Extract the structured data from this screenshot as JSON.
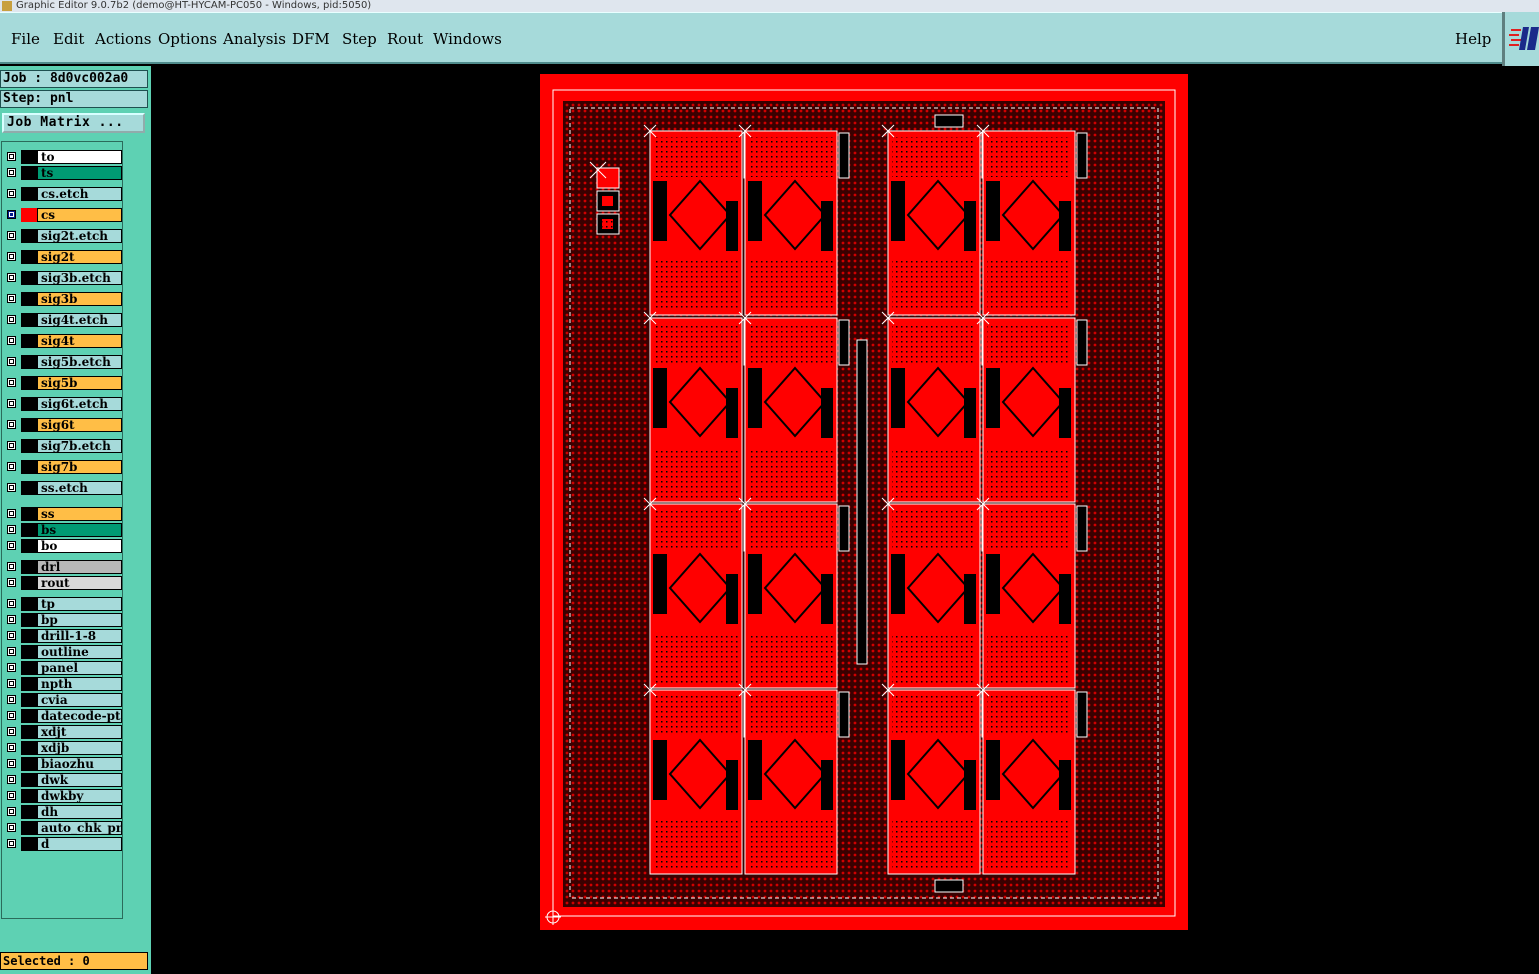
{
  "window": {
    "title": "Graphic Editor 9.0.7b2 (demo@HT-HYCAM-PC050 - Windows, pid:5050)"
  },
  "menu": {
    "file": "File",
    "edit": "Edit",
    "actions": "Actions",
    "options": "Options",
    "analysis": "Analysis",
    "dfm": "DFM",
    "step": "Step",
    "rout": "Rout",
    "windows": "Windows",
    "help": "Help"
  },
  "job": {
    "label": "Job : 8d0vc002a0",
    "step_label": "Step: pnl",
    "matrix_button": "Job Matrix ..."
  },
  "layers": [
    {
      "name": "to",
      "color": "white"
    },
    {
      "name": "ts",
      "color": "green"
    },
    {
      "name": "cs.etch",
      "color": "teal"
    },
    {
      "name": "cs",
      "color": "orange",
      "active": true
    },
    {
      "name": "sig2t.etch",
      "color": "teal"
    },
    {
      "name": "sig2t",
      "color": "orange"
    },
    {
      "name": "sig3b.etch",
      "color": "teal"
    },
    {
      "name": "sig3b",
      "color": "orange"
    },
    {
      "name": "sig4t.etch",
      "color": "teal"
    },
    {
      "name": "sig4t",
      "color": "orange"
    },
    {
      "name": "sig5b.etch",
      "color": "teal"
    },
    {
      "name": "sig5b",
      "color": "orange"
    },
    {
      "name": "sig6t.etch",
      "color": "teal"
    },
    {
      "name": "sig6t",
      "color": "orange"
    },
    {
      "name": "sig7b.etch",
      "color": "teal"
    },
    {
      "name": "sig7b",
      "color": "orange"
    },
    {
      "name": "ss.etch",
      "color": "teal"
    },
    {
      "name": "ss",
      "color": "orange"
    },
    {
      "name": "bs",
      "color": "green"
    },
    {
      "name": "bo",
      "color": "white"
    },
    {
      "name": "drl",
      "color": "gray"
    },
    {
      "name": "rout",
      "color": "lgray"
    },
    {
      "name": "tp",
      "color": "teal"
    },
    {
      "name": "bp",
      "color": "teal"
    },
    {
      "name": "drill-1-8",
      "color": "teal"
    },
    {
      "name": "outline",
      "color": "teal"
    },
    {
      "name": "panel",
      "color": "teal"
    },
    {
      "name": "npth",
      "color": "teal"
    },
    {
      "name": "cvia",
      "color": "teal"
    },
    {
      "name": "datecode-pt",
      "color": "teal"
    },
    {
      "name": "xdjt",
      "color": "teal"
    },
    {
      "name": "xdjb",
      "color": "teal"
    },
    {
      "name": "biaozhu",
      "color": "teal"
    },
    {
      "name": "dwk",
      "color": "teal"
    },
    {
      "name": "dwkby",
      "color": "teal"
    },
    {
      "name": "dh",
      "color": "teal"
    },
    {
      "name": "auto_chk_pnl",
      "color": "teal"
    },
    {
      "name": "d",
      "color": "teal"
    }
  ],
  "status": {
    "selected": "Selected : 0"
  },
  "colors": {
    "layer_red": "#ff0000",
    "panel_bg": "#5ed1b3",
    "menu_bg": "#a6dada",
    "orange": "#ffbe46"
  },
  "canvas": {
    "pcb_grid": {
      "columns": 4,
      "rows": 4
    }
  }
}
